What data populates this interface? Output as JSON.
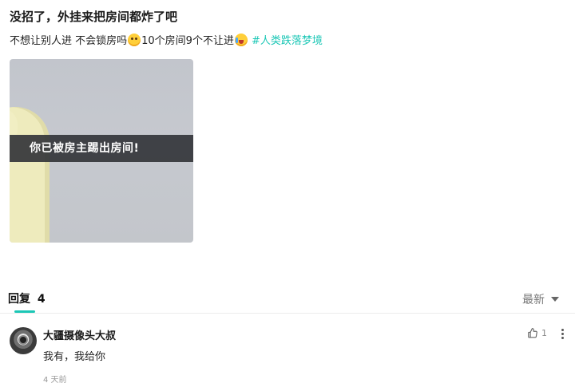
{
  "post": {
    "title": "没招了，外挂来把房间都炸了吧",
    "body_part1": "不想让别人进 不会锁房吗",
    "body_part2": "10个房间9个不让进",
    "hashtag": "#人类跌落梦境",
    "image_caption": "你已被房主踢出房间!"
  },
  "replies": {
    "label": "回复",
    "count": "4",
    "sort_label": "最新",
    "accent_color": "#1cc7b6"
  },
  "comment": {
    "username": "大疆摄像头大叔",
    "text": "我有，我给你",
    "time": "4 天前",
    "like_count": "1"
  }
}
